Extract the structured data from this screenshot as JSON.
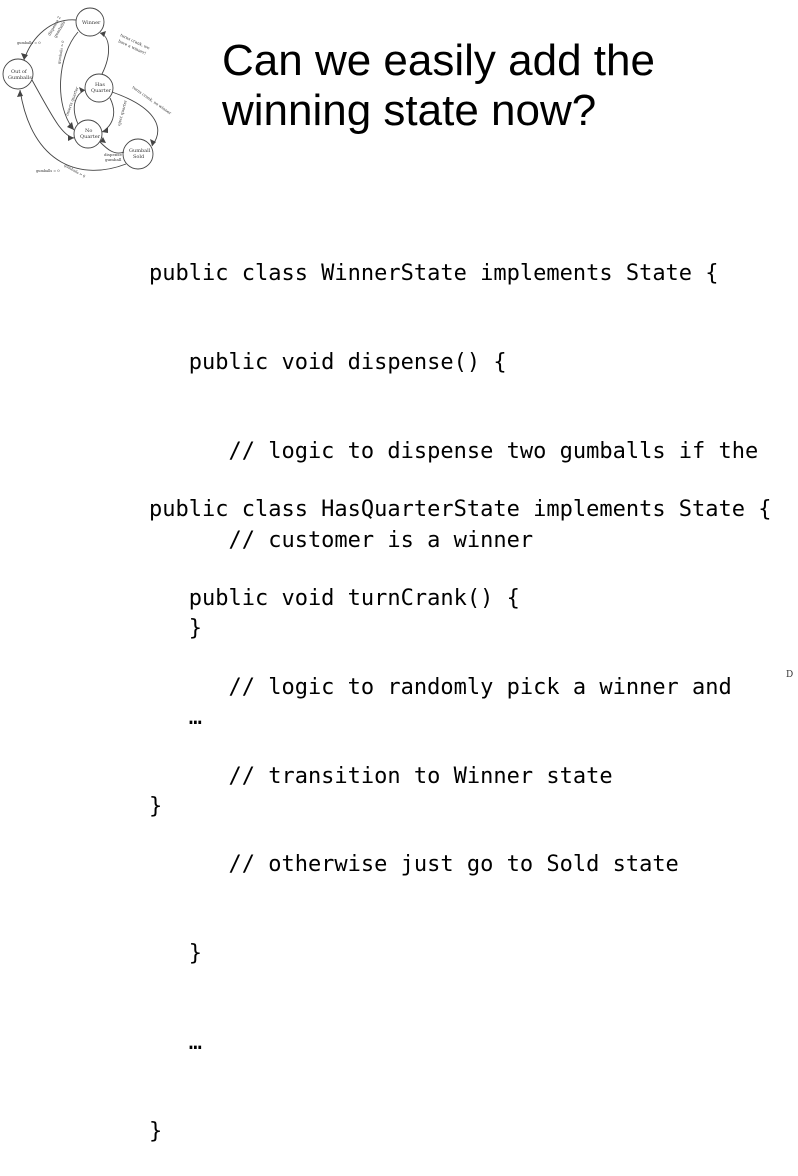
{
  "title": {
    "line1": "Can we easily add the",
    "line2": "winning state now?"
  },
  "diagram": {
    "states": {
      "winner": "Winner",
      "out_of_gumballs_1": "Out of",
      "out_of_gumballs_2": "Gumballs",
      "has_quarter_1": "Has",
      "has_quarter_2": "Quarter",
      "no_quarter_1": "No",
      "no_quarter_2": "Quarter",
      "gumball_sold_1": "Gumball",
      "gumball_sold_2": "Sold"
    },
    "transitions": {
      "dispense_two_1": "dispense 2",
      "dispense_two_2": "gumballs",
      "turn_crank_winner_1": "turns crank, we",
      "turn_crank_winner_2": "have a winner!",
      "turn_crank_no_winner": "turns crank, no winner",
      "insert_quarter": "inserts quarter",
      "eject_quarter": "eject quarter",
      "dispense_gumball_1": "dispense",
      "dispense_gumball_2": "gumball",
      "gumballs_eq_0_a": "gumballs = 0",
      "gumballs_gt_0_a": "gumballs > 0",
      "gumballs_eq_0_b": "gumballs = 0",
      "gumballs_gt_0_b": "gumballs > 0"
    }
  },
  "code_blocks": [
    {
      "lines": [
        "public class WinnerState implements State {",
        "   public void dispense() {",
        "      // logic to dispense two gumballs if the",
        "      // customer is a winner",
        "   }",
        "   …",
        "}"
      ]
    },
    {
      "lines": [
        "public class HasQuarterState implements State {",
        "   public void turnCrank() {",
        "      // logic to randomly pick a winner and",
        "      // transition to Winner state",
        "      // otherwise just go to Sold state",
        "   }",
        "   …",
        "}"
      ]
    }
  ],
  "footer_mark": "D"
}
